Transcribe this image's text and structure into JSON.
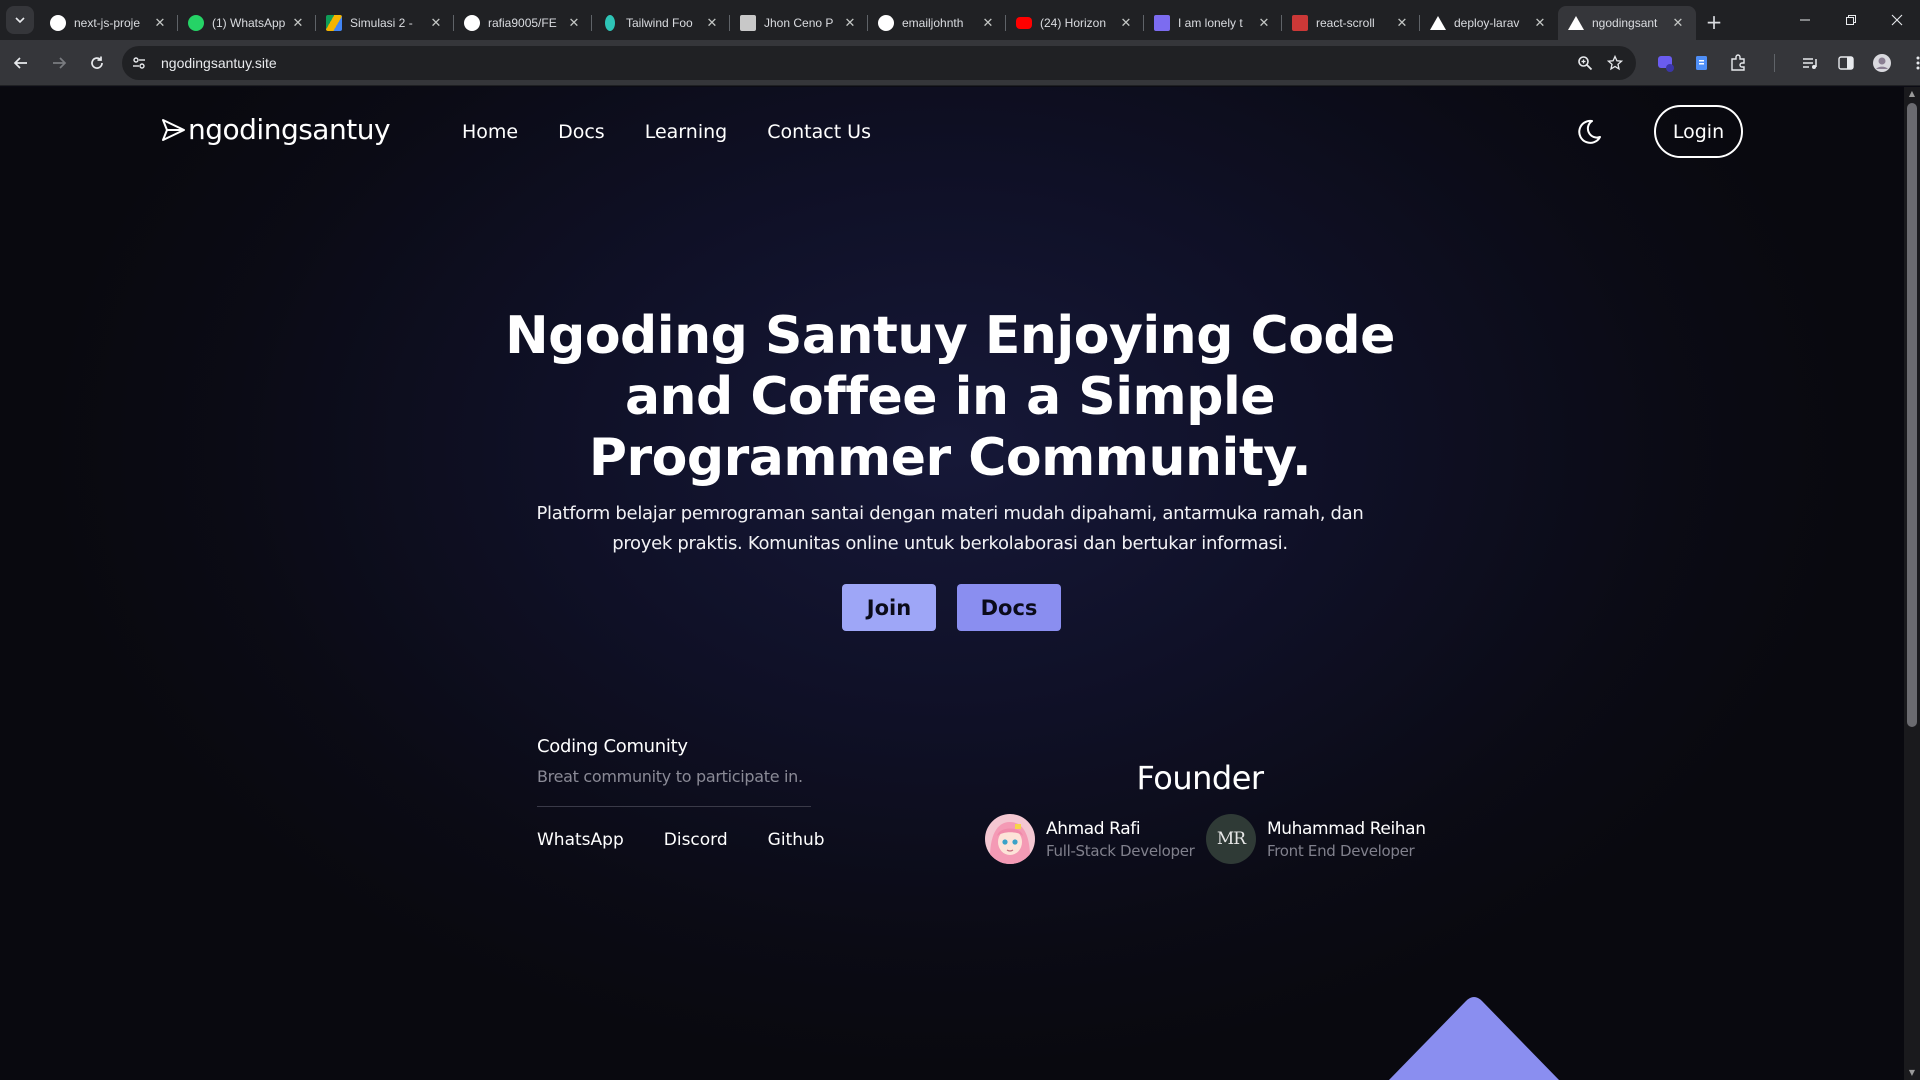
{
  "browser": {
    "tabs": [
      {
        "title": "next-js-proje",
        "icon": "github-icon",
        "color": "#ffffff",
        "active": false
      },
      {
        "title": "(1) WhatsApp",
        "icon": "whatsapp-icon",
        "color": "#25d366",
        "active": false
      },
      {
        "title": "Simulasi 2 -",
        "icon": "google-drive-icon",
        "color": "#f4b400",
        "active": false
      },
      {
        "title": "rafia9005/FE",
        "icon": "github-icon",
        "color": "#ffffff",
        "active": false
      },
      {
        "title": "Tailwind Foo",
        "icon": "tailwind-icon",
        "color": "#38bdf8",
        "active": false
      },
      {
        "title": "Jhon Ceno P",
        "icon": "figma-icon",
        "color": "#c8c8c8",
        "active": false
      },
      {
        "title": "emailjohnth",
        "icon": "github-icon",
        "color": "#ffffff",
        "active": false
      },
      {
        "title": "(24) Horizon",
        "icon": "youtube-icon",
        "color": "#ff0000",
        "active": false
      },
      {
        "title": "I am lonely t",
        "icon": "bookmark-icon",
        "color": "#7c6cf0",
        "active": false
      },
      {
        "title": "react-scroll",
        "icon": "npm-icon",
        "color": "#cb3837",
        "active": false
      },
      {
        "title": "deploy-larav",
        "icon": "vercel-icon",
        "color": "#ffffff",
        "active": false
      },
      {
        "title": "ngodingsant",
        "icon": "vercel-icon",
        "color": "#ffffff",
        "active": true
      }
    ],
    "url": "ngodingsantuy.site"
  },
  "nav": {
    "brand": "ngodingsantuy",
    "links": [
      "Home",
      "Docs",
      "Learning",
      "Contact Us"
    ],
    "login_label": "Login"
  },
  "hero": {
    "title": "Ngoding Santuy Enjoying Code and Coffee in a Simple Programmer Community.",
    "description": "Platform belajar pemrograman santai dengan materi mudah dipahami, antarmuka ramah, dan proyek praktis. Komunitas online untuk berkolaborasi dan bertukar informasi.",
    "join_label": "Join",
    "docs_label": "Docs"
  },
  "community": {
    "title": "Coding Comunity",
    "subtitle": "Breat community to participate in.",
    "links": [
      "WhatsApp",
      "Discord",
      "Github"
    ]
  },
  "founder": {
    "heading": "Founder",
    "people": [
      {
        "name": "Ahmad Rafi",
        "role": "Full-Stack Developer",
        "avatar": "anime-avatar"
      },
      {
        "name": "Muhammad Reihan",
        "role": "Front End Developer",
        "avatar": "MR"
      }
    ]
  },
  "colors": {
    "accent_join": "#9ea6f7",
    "accent_docs": "#8a8ef0",
    "decoration": "#8a8ef0"
  }
}
